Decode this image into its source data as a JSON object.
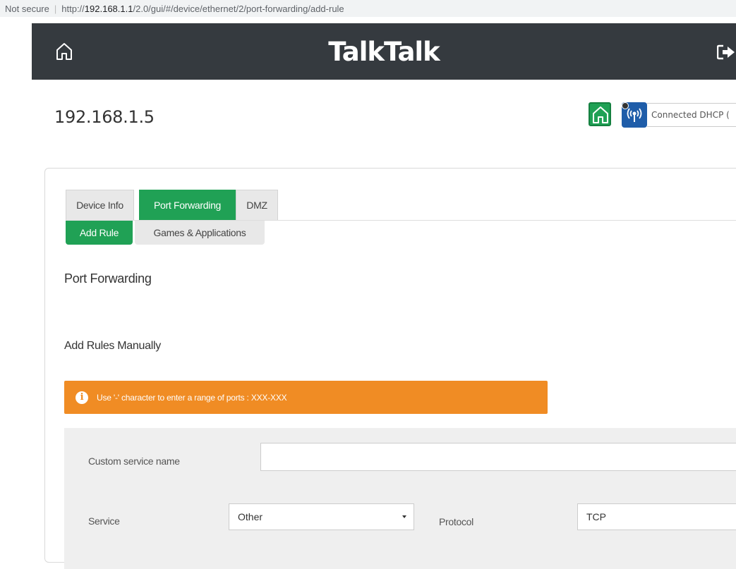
{
  "browser": {
    "security_label": "Not secure",
    "url_scheme": "http://",
    "url_host": "192.168.1.1",
    "url_path": "/2.0/gui/#/device/ethernet/2/port-forwarding/add-rule"
  },
  "header": {
    "brand": "TalkTalk",
    "background_color": "#353a3f"
  },
  "device": {
    "title": "192.168.1.5",
    "status_text": "Connected DHCP ("
  },
  "tabs": [
    {
      "label": "Device Info",
      "active": false
    },
    {
      "label": "Port Forwarding",
      "active": true
    },
    {
      "label": "DMZ",
      "active": false
    }
  ],
  "subtabs": [
    {
      "label": "Add Rule",
      "active": true
    },
    {
      "label": "Games & Applications",
      "active": false
    }
  ],
  "section": {
    "title": "Port Forwarding",
    "subtitle": "Add Rules Manually"
  },
  "alert": {
    "text": "Use '-' character to enter a range of ports : XXX-XXX",
    "icon": "info-icon",
    "color": "#f08c24"
  },
  "form": {
    "custom_service_label": "Custom service name",
    "custom_service_value": "",
    "service_label": "Service",
    "service_value": "Other",
    "protocol_label": "Protocol",
    "protocol_value": "TCP"
  },
  "colors": {
    "accent_green": "#20a155",
    "wifi_blue": "#1f5da9"
  }
}
